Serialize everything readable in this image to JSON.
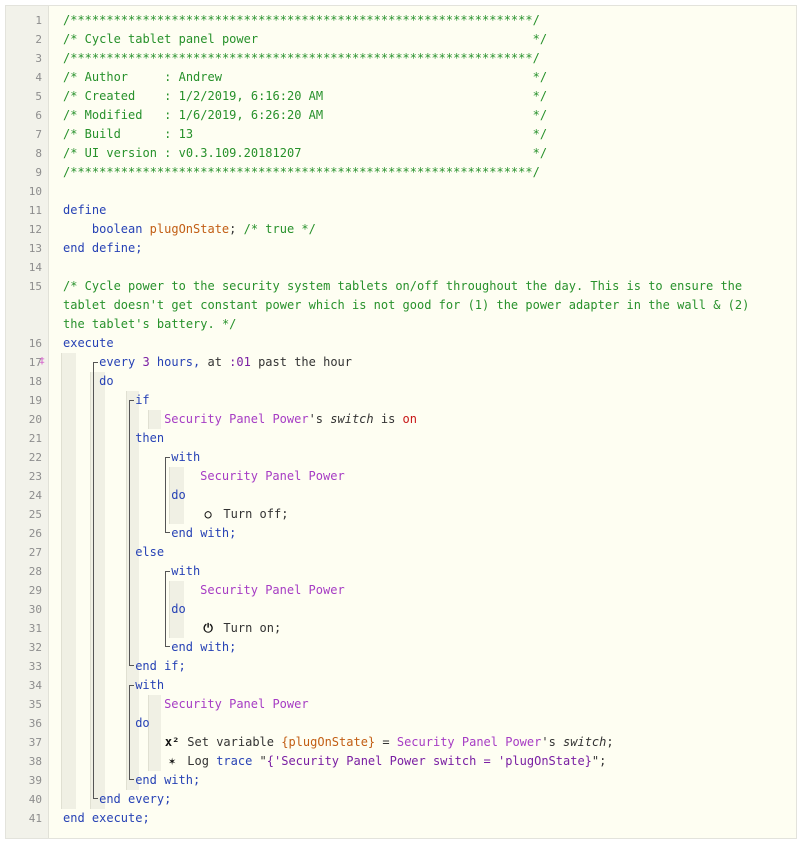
{
  "lines": [
    {
      "n": "1",
      "segments": [
        {
          "t": "/****************************************************************/",
          "c": "comment"
        }
      ]
    },
    {
      "n": "2",
      "segments": [
        {
          "t": "/* Cycle tablet panel power                                      */",
          "c": "comment"
        }
      ]
    },
    {
      "n": "3",
      "segments": [
        {
          "t": "/****************************************************************/",
          "c": "comment"
        }
      ]
    },
    {
      "n": "4",
      "segments": [
        {
          "t": "/* Author     : Andrew                                           */",
          "c": "comment"
        }
      ]
    },
    {
      "n": "5",
      "segments": [
        {
          "t": "/* Created    : 1/2/2019, 6:16:20 AM                             */",
          "c": "comment"
        }
      ]
    },
    {
      "n": "6",
      "segments": [
        {
          "t": "/* Modified   : 1/6/2019, 6:26:20 AM                             */",
          "c": "comment"
        }
      ]
    },
    {
      "n": "7",
      "segments": [
        {
          "t": "/* Build      : 13                                               */",
          "c": "comment"
        }
      ]
    },
    {
      "n": "8",
      "segments": [
        {
          "t": "/* UI version : v0.3.109.20181207                                */",
          "c": "comment"
        }
      ]
    },
    {
      "n": "9",
      "segments": [
        {
          "t": "/****************************************************************/",
          "c": "comment"
        }
      ]
    },
    {
      "n": "10",
      "segments": []
    },
    {
      "n": "11",
      "segments": [
        {
          "t": "define",
          "c": "kw"
        }
      ]
    },
    {
      "n": "12",
      "indent": 4,
      "segments": [
        {
          "t": "boolean ",
          "c": "kw"
        },
        {
          "t": "plugOnState",
          "c": "var"
        },
        {
          "t": "; ",
          "c": "plain"
        },
        {
          "t": "/* true */",
          "c": "comment"
        }
      ]
    },
    {
      "n": "13",
      "segments": [
        {
          "t": "end define;",
          "c": "kw"
        }
      ]
    },
    {
      "n": "14",
      "segments": []
    },
    {
      "n": "15",
      "wrap": true,
      "segments": [
        {
          "t": "/* Cycle power to the security system tablets on/off throughout the day. This is to ensure the tablet doesn't get constant power which is not good for (1) the power adapter in the wall & (2) the tablet's battery. */",
          "c": "comment"
        }
      ]
    },
    {
      "n": "16",
      "segments": [
        {
          "t": "execute",
          "c": "kw"
        }
      ]
    },
    {
      "n": "17",
      "marker": true,
      "indent": 5,
      "segments": [
        {
          "t": "every ",
          "c": "kw"
        },
        {
          "t": "3",
          "c": "num"
        },
        {
          "t": " hours, ",
          "c": "kw"
        },
        {
          "t": "at ",
          "c": "plain"
        },
        {
          "t": ":01",
          "c": "num"
        },
        {
          "t": " past the hour",
          "c": "plain"
        }
      ]
    },
    {
      "n": "18",
      "indent": 5,
      "segments": [
        {
          "t": "do",
          "c": "kw"
        }
      ]
    },
    {
      "n": "19",
      "indent": 10,
      "segments": [
        {
          "t": "if",
          "c": "kw"
        }
      ]
    },
    {
      "n": "20",
      "indent": 14,
      "segments": [
        {
          "t": "Security Panel Power",
          "c": "dev"
        },
        {
          "t": "'s ",
          "c": "plain"
        },
        {
          "t": "switch",
          "c": "italic"
        },
        {
          "t": " is ",
          "c": "plain"
        },
        {
          "t": "on",
          "c": "state"
        }
      ]
    },
    {
      "n": "21",
      "indent": 10,
      "segments": [
        {
          "t": "then",
          "c": "kw"
        }
      ]
    },
    {
      "n": "22",
      "indent": 15,
      "segments": [
        {
          "t": "with",
          "c": "kw"
        }
      ]
    },
    {
      "n": "23",
      "indent": 19,
      "segments": [
        {
          "t": "Security Panel Power",
          "c": "dev"
        }
      ]
    },
    {
      "n": "24",
      "indent": 15,
      "segments": [
        {
          "t": "do",
          "c": "kw"
        }
      ]
    },
    {
      "n": "25",
      "indent": 19,
      "icon": "power-off-icon",
      "iconGlyph": "○",
      "segments": [
        {
          "t": " Turn off;",
          "c": "plain"
        }
      ]
    },
    {
      "n": "26",
      "indent": 15,
      "segments": [
        {
          "t": "end with;",
          "c": "kw"
        }
      ]
    },
    {
      "n": "27",
      "indent": 10,
      "segments": [
        {
          "t": "else",
          "c": "kw"
        }
      ]
    },
    {
      "n": "28",
      "indent": 15,
      "segments": [
        {
          "t": "with",
          "c": "kw"
        }
      ]
    },
    {
      "n": "29",
      "indent": 19,
      "segments": [
        {
          "t": "Security Panel Power",
          "c": "dev"
        }
      ]
    },
    {
      "n": "30",
      "indent": 15,
      "segments": [
        {
          "t": "do",
          "c": "kw"
        }
      ]
    },
    {
      "n": "31",
      "indent": 19,
      "icon": "power-on-icon",
      "iconGlyph": "⏻",
      "segments": [
        {
          "t": " Turn on;",
          "c": "plain"
        }
      ]
    },
    {
      "n": "32",
      "indent": 15,
      "segments": [
        {
          "t": "end with;",
          "c": "kw"
        }
      ]
    },
    {
      "n": "33",
      "indent": 10,
      "segments": [
        {
          "t": "end if;",
          "c": "kw"
        }
      ]
    },
    {
      "n": "34",
      "indent": 10,
      "segments": [
        {
          "t": "with",
          "c": "kw"
        }
      ]
    },
    {
      "n": "35",
      "indent": 14,
      "segments": [
        {
          "t": "Security Panel Power",
          "c": "dev"
        }
      ]
    },
    {
      "n": "36",
      "indent": 10,
      "segments": [
        {
          "t": "do",
          "c": "kw"
        }
      ]
    },
    {
      "n": "37",
      "indent": 14,
      "icon": "set-variable-icon",
      "iconGlyph": "x²",
      "segments": [
        {
          "t": " Set variable ",
          "c": "plain"
        },
        {
          "t": "{plugOnState}",
          "c": "var"
        },
        {
          "t": " = ",
          "c": "plain"
        },
        {
          "t": "Security Panel Power",
          "c": "dev"
        },
        {
          "t": "'s ",
          "c": "plain"
        },
        {
          "t": "switch",
          "c": "italic"
        },
        {
          "t": ";",
          "c": "plain"
        }
      ]
    },
    {
      "n": "38",
      "indent": 14,
      "icon": "log-bug-icon",
      "iconGlyph": "✶",
      "segments": [
        {
          "t": " Log ",
          "c": "plain"
        },
        {
          "t": "trace",
          "c": "kw"
        },
        {
          "t": " \"",
          "c": "plain"
        },
        {
          "t": "{'Security Panel Power switch = 'plugOnState}",
          "c": "str"
        },
        {
          "t": "\";",
          "c": "plain"
        }
      ]
    },
    {
      "n": "39",
      "indent": 10,
      "segments": [
        {
          "t": "end with;",
          "c": "kw"
        }
      ]
    },
    {
      "n": "40",
      "indent": 5,
      "segments": [
        {
          "t": "end every;",
          "c": "kw"
        }
      ]
    },
    {
      "n": "41",
      "segments": [
        {
          "t": "end execute;",
          "c": "kw"
        }
      ]
    }
  ]
}
